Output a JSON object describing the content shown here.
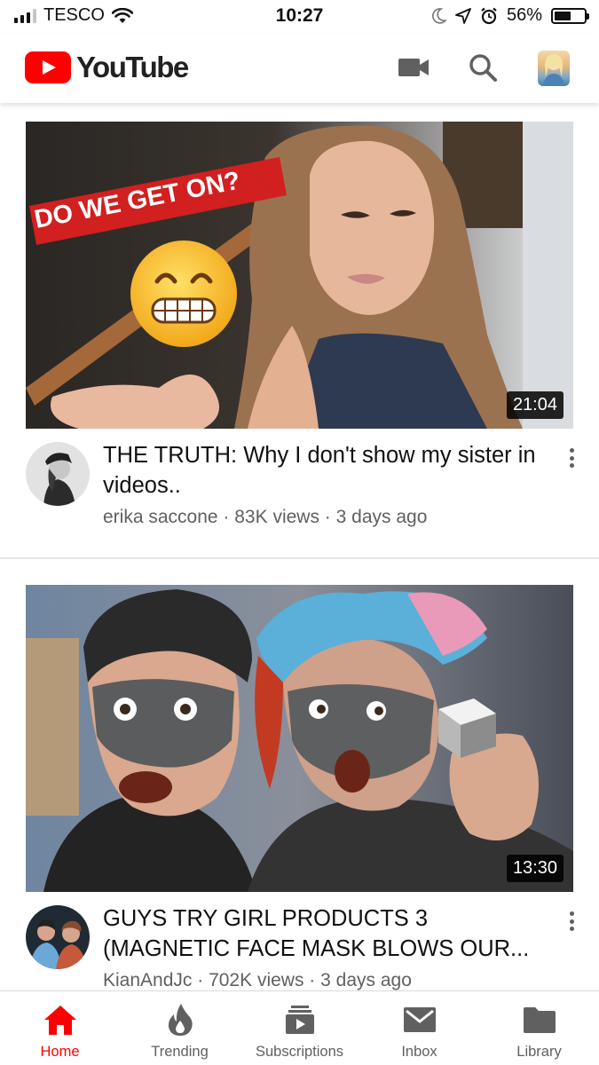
{
  "status_bar": {
    "carrier": "TESCO",
    "time": "10:27",
    "battery": "56%",
    "battery_level": 0.56,
    "icons": [
      "signal-bars-icon",
      "wifi-icon",
      "moon-icon",
      "location-arrow-icon",
      "alarm-icon",
      "battery-icon"
    ]
  },
  "header": {
    "logo_text": "YouTube",
    "icons": [
      "camera-icon",
      "search-icon",
      "account-avatar"
    ]
  },
  "videos": [
    {
      "title": "THE TRUTH: Why I don't show my sister in videos..",
      "channel": "erika saccone",
      "views": "83K views",
      "age": "3 days ago",
      "duration": "21:04",
      "thumb_caption": "DO WE GET ON?"
    },
    {
      "title": "GUYS TRY GIRL PRODUCTS 3 (MAGNETIC FACE MASK BLOWS OUR...",
      "channel": "KianAndJc",
      "views": "702K views",
      "age": "3 days ago",
      "duration": "13:30"
    }
  ],
  "separator": " · ",
  "bottom_nav": [
    {
      "label": "Home",
      "icon": "home-icon",
      "active": true
    },
    {
      "label": "Trending",
      "icon": "flame-icon",
      "active": false
    },
    {
      "label": "Subscriptions",
      "icon": "subscriptions-icon",
      "active": false
    },
    {
      "label": "Inbox",
      "icon": "mail-icon",
      "active": false
    },
    {
      "label": "Library",
      "icon": "folder-icon",
      "active": false
    }
  ],
  "colors": {
    "brand_red": "#ff0000",
    "text_primary": "#111111",
    "text_secondary": "#606060",
    "icon_gray": "#606060"
  }
}
